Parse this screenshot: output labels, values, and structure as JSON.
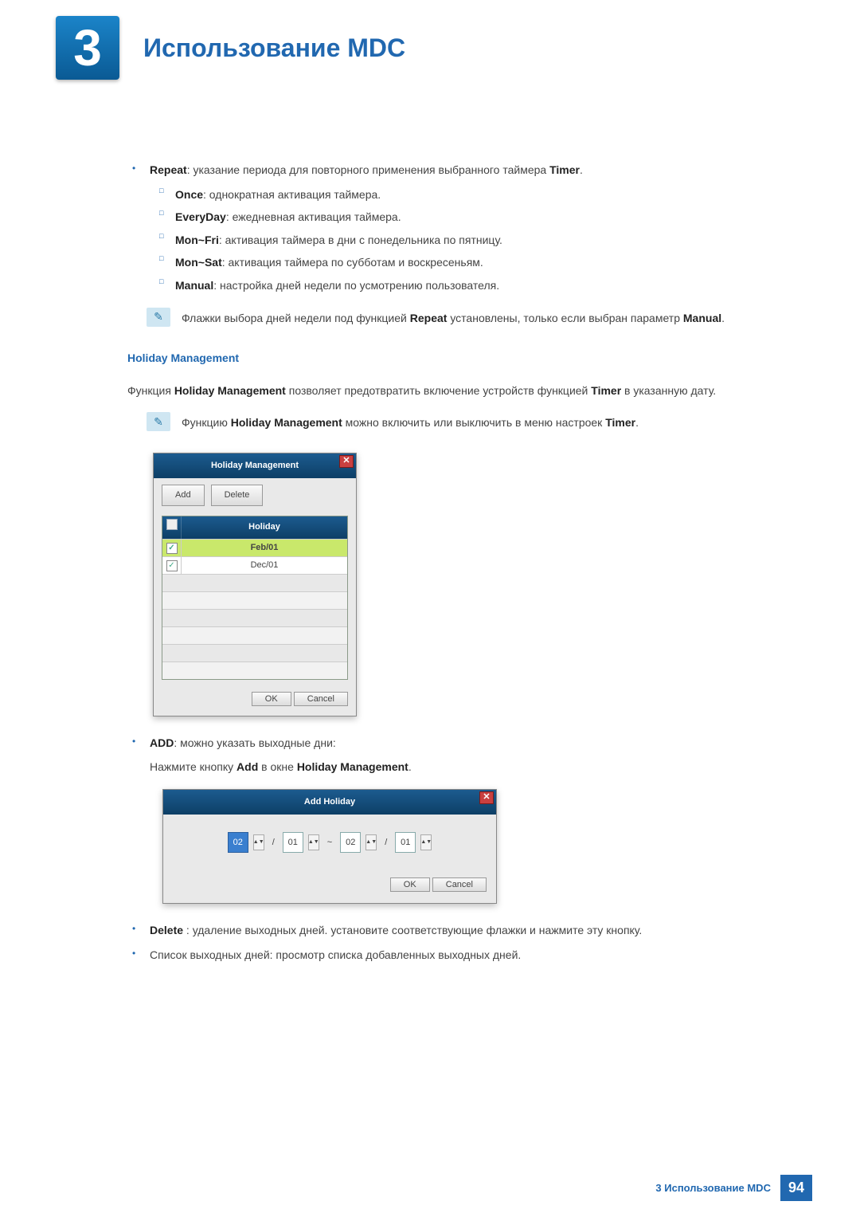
{
  "chapter": {
    "number": "3",
    "title": "Использование MDC"
  },
  "repeat": {
    "intro_bold": "Repeat",
    "intro_rest": ": указание периода для повторного применения выбранного таймера ",
    "intro_trail_bold": "Timer",
    "intro_trail_rest": ".",
    "items": [
      {
        "bold": "Once",
        "rest": ": однократная активация таймера."
      },
      {
        "bold": "EveryDay",
        "rest": ": ежедневная активация таймера."
      },
      {
        "bold": "Mon~Fri",
        "rest": ": активация таймера в дни с понедельника по пятницу."
      },
      {
        "bold": "Mon~Sat",
        "rest": ": активация таймера по субботам и воскресеньям."
      },
      {
        "bold": "Manual",
        "rest": ": настройка дней недели по усмотрению пользователя."
      }
    ],
    "note_pre": "Флажки выбора дней недели под функцией ",
    "note_b1": "Repeat",
    "note_mid": " установлены, только если выбран параметр ",
    "note_b2": "Manual",
    "note_end": "."
  },
  "hm_section": {
    "title": "Holiday Management",
    "desc_pre": "Функция ",
    "desc_b1": "Holiday Management",
    "desc_mid": " позволяет предотвратить включение устройств функцией ",
    "desc_b2": "Timer",
    "desc_end": " в указанную дату.",
    "note_pre": "Функцию ",
    "note_b1": "Holiday Management",
    "note_mid": " можно включить или выключить в меню настроек ",
    "note_b2": "Timer",
    "note_end": "."
  },
  "hm_dialog": {
    "title": "Holiday Management",
    "close": "✕",
    "add_btn": "Add",
    "delete_btn": "Delete",
    "col_holiday": "Holiday",
    "rows": [
      {
        "checked": "✓",
        "date": "Feb/01",
        "selected": true
      },
      {
        "checked": "✓",
        "date": "Dec/01",
        "selected": false
      }
    ],
    "ok_btn": "OK",
    "cancel_btn": "Cancel"
  },
  "add_item": {
    "bold": "ADD",
    "rest": ": можно указать выходные дни:",
    "line2_pre": "Нажмите кнопку ",
    "line2_b1": "Add",
    "line2_mid": " в окне ",
    "line2_b2": "Holiday Management",
    "line2_end": "."
  },
  "ah_dialog": {
    "title": "Add Holiday",
    "close": "✕",
    "m1": "02",
    "d1": "01",
    "tilde": "~",
    "m2": "02",
    "d2": "01",
    "slash": "/",
    "spin": "▲▼",
    "ok_btn": "OK",
    "cancel_btn": "Cancel"
  },
  "delete_item": {
    "bold": "Delete",
    "rest": " : удаление выходных дней. установите соответствующие флажки и нажмите эту кнопку."
  },
  "list_item": {
    "text": "Список выходных дней: просмотр списка добавленных выходных дней."
  },
  "footer": {
    "label": "3 Использование MDC",
    "page": "94"
  }
}
